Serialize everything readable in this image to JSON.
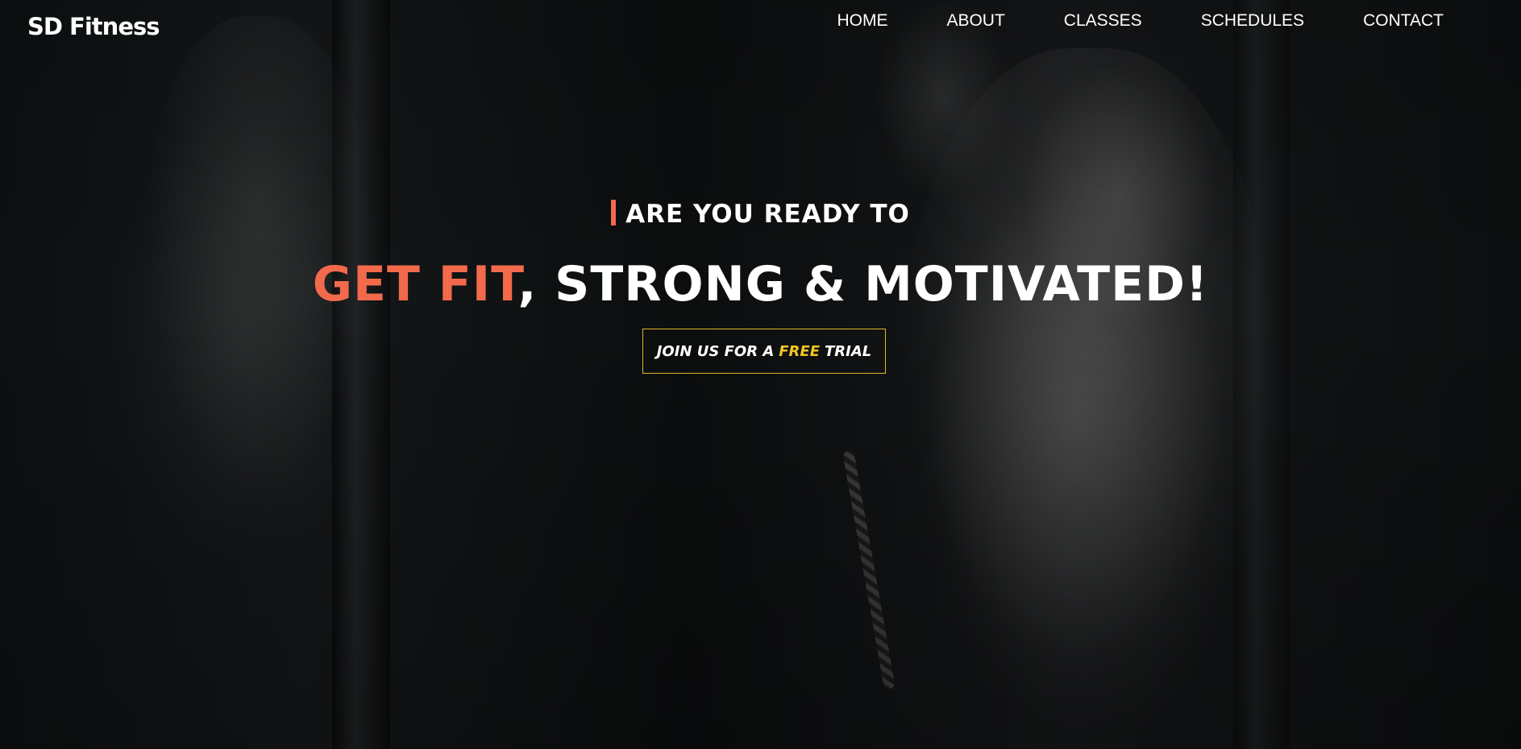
{
  "header": {
    "logo": "SD Fitness",
    "nav": [
      {
        "label": "HOME"
      },
      {
        "label": "ABOUT"
      },
      {
        "label": "CLASSES"
      },
      {
        "label": "SCHEDULES"
      },
      {
        "label": "CONTACT"
      }
    ]
  },
  "hero": {
    "eyebrow": "ARE YOU READY TO",
    "headline_accent": "GET FIT",
    "headline_rest": ", STRONG & MOTIVATED!",
    "cta_prefix": "JOIN US FOR A",
    "cta_highlight": "FREE",
    "cta_suffix": "TRIAL"
  },
  "colors": {
    "accent": "#f26a4b",
    "highlight": "#f3c623",
    "cta_border": "#e0b92c",
    "text": "#ffffff"
  }
}
